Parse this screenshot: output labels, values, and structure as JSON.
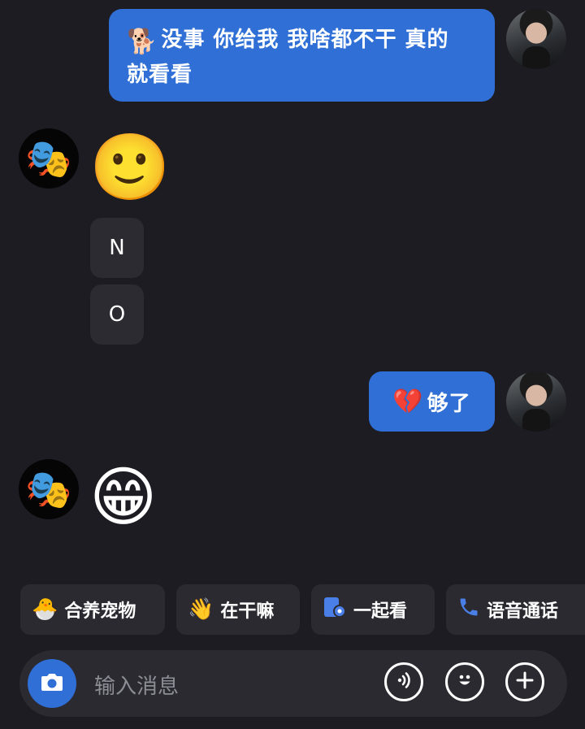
{
  "messages": [
    {
      "side": "out",
      "emoji": "🐕",
      "text": "没事 你给我 我啥都不干 真的 就看看"
    },
    {
      "side": "in",
      "emoji": "🙂"
    },
    {
      "side": "in",
      "text": "N"
    },
    {
      "side": "in",
      "text": "O"
    },
    {
      "side": "out",
      "emoji": "💔",
      "text": "够了"
    },
    {
      "side": "in",
      "emoji": "😁"
    }
  ],
  "quick_actions": [
    {
      "label": "合养宠物",
      "icon": "pet-icon"
    },
    {
      "label": "在干嘛",
      "icon": "wave-icon"
    },
    {
      "label": "一起看",
      "icon": "watch-together-icon"
    },
    {
      "label": "语音通话",
      "icon": "phone-icon"
    }
  ],
  "input": {
    "placeholder": "输入消息"
  },
  "colors": {
    "background": "#1c1c22",
    "outgoing_bubble": "#2f6fd6",
    "incoming_bubble": "#2b2b31",
    "accent": "#2f6fd6"
  }
}
